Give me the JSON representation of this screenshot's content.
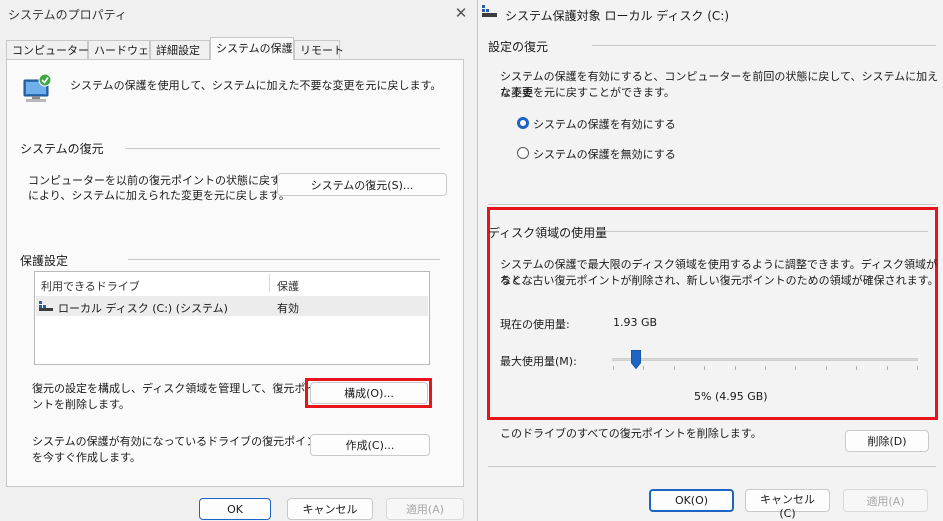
{
  "left": {
    "title": "システムのプロパティ",
    "tabs": [
      "コンピューター名",
      "ハードウェア",
      "詳細設定",
      "システムの保護",
      "リモート"
    ],
    "intro": "システムの保護を使用して、システムに加えた不要な変更を元に戻します。",
    "restore": {
      "heading": "システムの復元",
      "desc_line1": "コンピューターを以前の復元ポイントの状態に戻すこと",
      "desc_line2": "により、システムに加えられた変更を元に戻します。",
      "button": "システムの復元(S)..."
    },
    "protection": {
      "heading": "保護設定",
      "col_drive": "利用できるドライブ",
      "col_protect": "保護",
      "rows": [
        {
          "drive": "ローカル ディスク (C:) (システム)",
          "status": "有効"
        }
      ],
      "configure_line1": "復元の設定を構成し、ディスク領域を管理して、復元ポイ",
      "configure_line2": "ントを削除します。",
      "configure_button": "構成(O)...",
      "create_line1": "システムの保護が有効になっているドライブの復元ポイント",
      "create_line2": "を今すぐ作成します。",
      "create_button": "作成(C)..."
    },
    "ok": "OK",
    "cancel": "キャンセル",
    "apply": "適用(A)"
  },
  "right": {
    "title": "システム保護対象 ローカル ディスク (C:)",
    "restore_settings": {
      "heading": "設定の復元",
      "desc_line1": "システムの保護を有効にすると、コンピューターを前回の状態に戻して、システムに加えた不要",
      "desc_line2": "な変更を元に戻すことができます。",
      "enable": "システムの保護を有効にする",
      "disable": "システムの保護を無効にする"
    },
    "disk_usage": {
      "heading": "ディスク領域の使用量",
      "desc_line1": "システムの保護で最大限のディスク領域を使用するように調整できます。ディスク領域がなくな",
      "desc_line2": "ると、古い復元ポイントが削除され、新しい復元ポイントのための領域が確保されます。",
      "current_label": "現在の使用量:",
      "current_value": "1.93 GB",
      "max_label": "最大使用量(M):",
      "max_fraction": 0.05,
      "max_value": "5% (4.95 GB)"
    },
    "delete_text": "このドライブのすべての復元ポイントを削除します。",
    "delete_button": "削除(D)",
    "ok": "OK(O)",
    "cancel": "キャンセル(C)",
    "apply": "適用(A)"
  },
  "colors": {
    "highlight": "#e8141c",
    "accent": "#1d64c4"
  }
}
